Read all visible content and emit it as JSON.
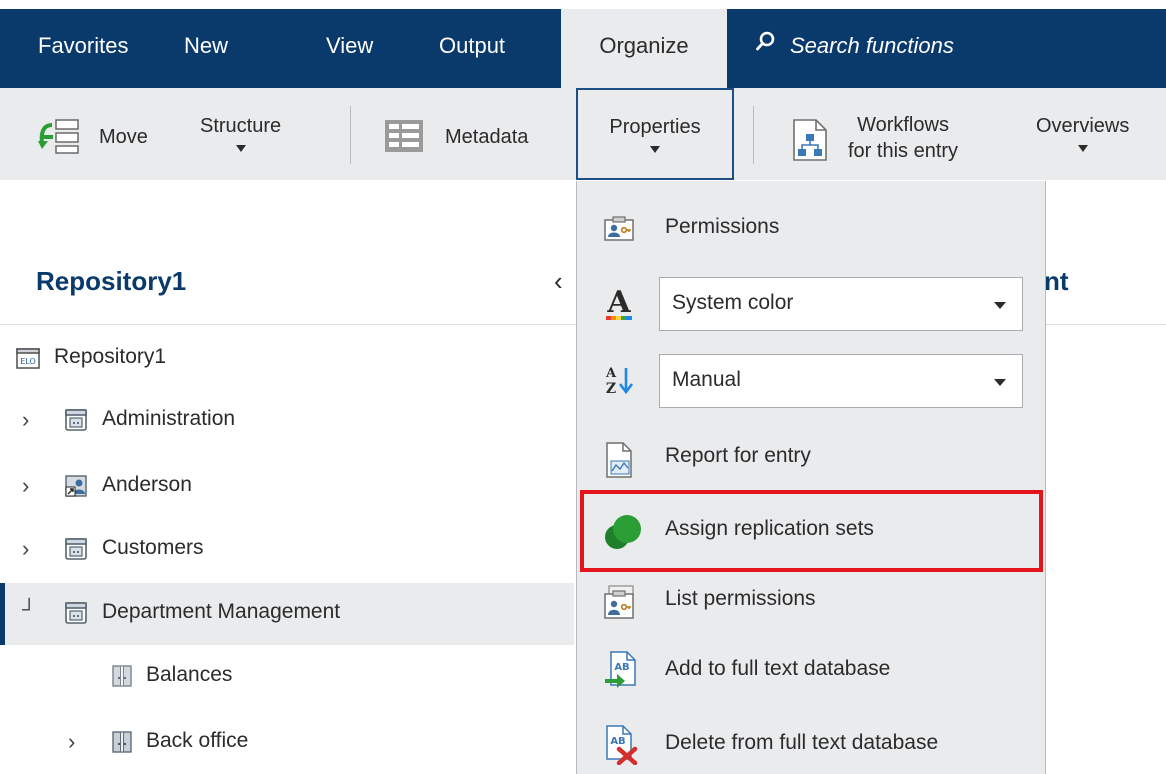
{
  "tabs": [
    {
      "label": "Favorites"
    },
    {
      "label": "New"
    },
    {
      "label": "View"
    },
    {
      "label": "Output"
    },
    {
      "label": "Organize",
      "active": true
    }
  ],
  "search": {
    "placeholder": "Search functions",
    "icon": "search-icon"
  },
  "ribbon": {
    "move": "Move",
    "structure": "Structure",
    "metadata": "Metadata",
    "properties": "Properties",
    "workflows_line1": "Workflows",
    "workflows_line2": "for this entry",
    "overviews": "Overviews"
  },
  "left_panel": {
    "title": "Repository1",
    "right_title_fragment": "nt",
    "tree": [
      {
        "label": "Repository1",
        "icon": "elo-repository-icon",
        "expander": ""
      },
      {
        "label": "Administration",
        "icon": "cabinet-icon",
        "expander": "chevron-right"
      },
      {
        "label": "Anderson",
        "icon": "user-folder-icon",
        "expander": "chevron-right"
      },
      {
        "label": "Customers",
        "icon": "cabinet-icon",
        "expander": "chevron-right"
      },
      {
        "label": "Department Management",
        "icon": "cabinet-icon",
        "expander": "collapse",
        "selected": true
      },
      {
        "label": "Balances",
        "icon": "folder-icon",
        "expander": ""
      },
      {
        "label": "Back office",
        "icon": "folder-icon",
        "expander": "chevron-right"
      }
    ]
  },
  "properties_menu": {
    "items": [
      {
        "label": "Permissions",
        "icon": "permissions-icon"
      },
      {
        "label": "Report for entry",
        "icon": "report-icon"
      },
      {
        "label": "Assign replication sets",
        "icon": "replication-icon",
        "highlighted": true
      },
      {
        "label": "List permissions",
        "icon": "list-permissions-icon"
      },
      {
        "label": "Add to full text database",
        "icon": "fulltext-add-icon"
      },
      {
        "label": "Delete from full text database",
        "icon": "fulltext-delete-icon"
      }
    ],
    "color_select": {
      "value": "System color",
      "icon": "font-color-icon"
    },
    "sort_select": {
      "value": "Manual",
      "icon": "sort-az-icon"
    }
  },
  "colors": {
    "navy": "#0a3a6b",
    "ribbon_bg": "#eaebed",
    "highlight": "#e3151a",
    "replication_green": "#2a9d35"
  }
}
